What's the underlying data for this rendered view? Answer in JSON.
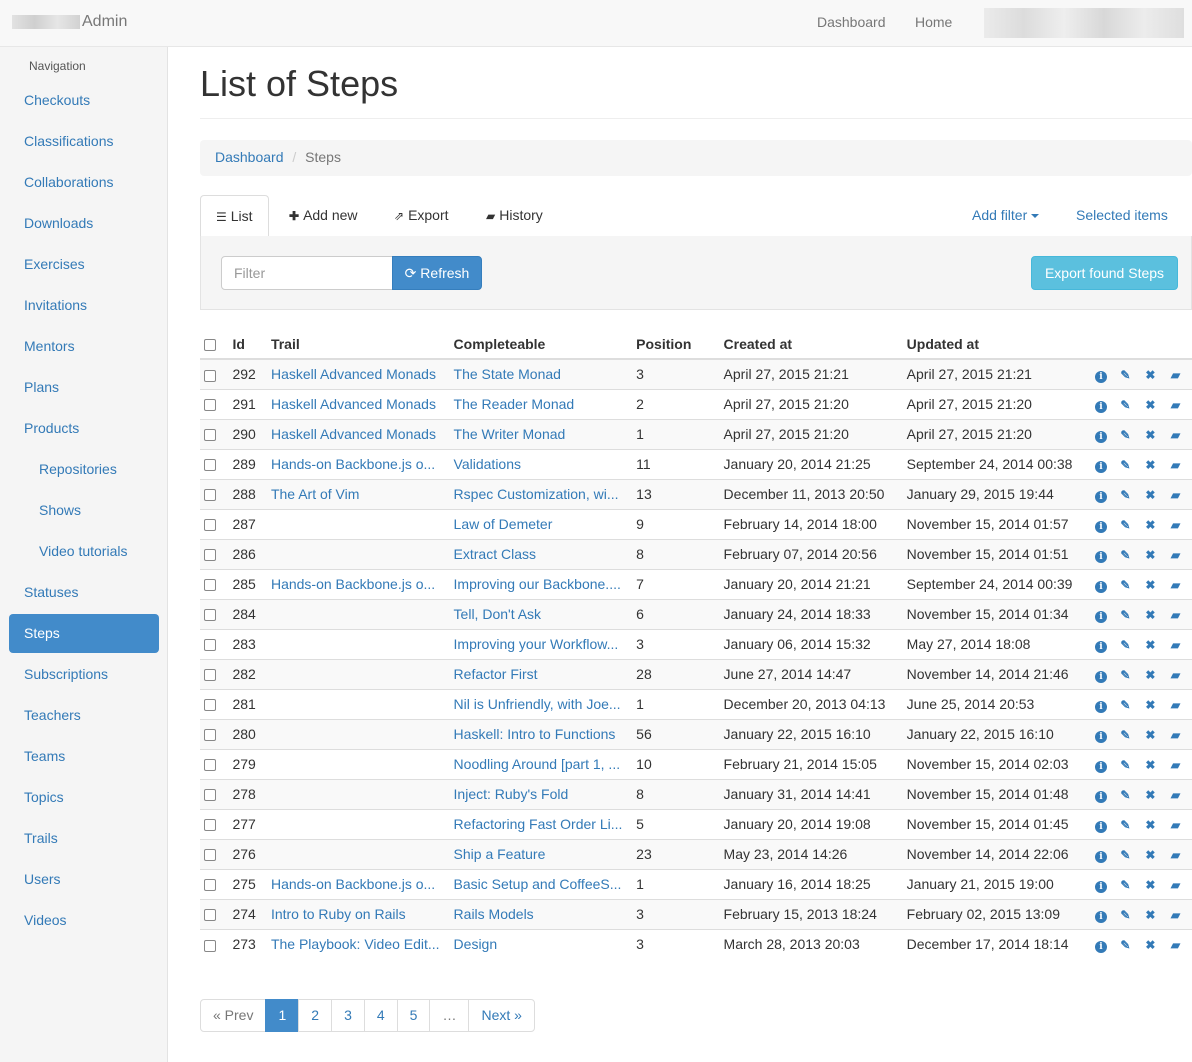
{
  "navbar": {
    "brand": "Admin",
    "links": [
      "Dashboard",
      "Home"
    ]
  },
  "sidebar": {
    "header": "Navigation",
    "items": [
      {
        "label": "Checkouts"
      },
      {
        "label": "Classifications"
      },
      {
        "label": "Collaborations"
      },
      {
        "label": "Downloads"
      },
      {
        "label": "Exercises"
      },
      {
        "label": "Invitations"
      },
      {
        "label": "Mentors"
      },
      {
        "label": "Plans"
      },
      {
        "label": "Products"
      },
      {
        "label": "Repositories",
        "sub": true
      },
      {
        "label": "Shows",
        "sub": true
      },
      {
        "label": "Video tutorials",
        "sub": true
      },
      {
        "label": "Statuses"
      },
      {
        "label": "Steps",
        "active": true
      },
      {
        "label": "Subscriptions"
      },
      {
        "label": "Teachers"
      },
      {
        "label": "Teams"
      },
      {
        "label": "Topics"
      },
      {
        "label": "Trails"
      },
      {
        "label": "Users"
      },
      {
        "label": "Videos"
      }
    ]
  },
  "page": {
    "title": "List of Steps",
    "breadcrumb": [
      "Dashboard",
      "Steps"
    ]
  },
  "tabs": {
    "list": "List",
    "add_new": "Add new",
    "export": "Export",
    "history": "History",
    "add_filter": "Add filter",
    "selected_items": "Selected items"
  },
  "filter": {
    "placeholder": "Filter",
    "refresh": "Refresh",
    "export_found": "Export found Steps"
  },
  "table": {
    "headers": [
      "Id",
      "Trail",
      "Completeable",
      "Position",
      "Created at",
      "Updated at"
    ],
    "rows": [
      [
        "292",
        "Haskell Advanced Monads",
        "The State Monad",
        "3",
        "April 27, 2015 21:21",
        "April 27, 2015 21:21"
      ],
      [
        "291",
        "Haskell Advanced Monads",
        "The Reader Monad",
        "2",
        "April 27, 2015 21:20",
        "April 27, 2015 21:20"
      ],
      [
        "290",
        "Haskell Advanced Monads",
        "The Writer Monad",
        "1",
        "April 27, 2015 21:20",
        "April 27, 2015 21:20"
      ],
      [
        "289",
        "Hands-on Backbone.js o...",
        "Validations",
        "11",
        "January 20, 2014 21:25",
        "September 24, 2014 00:38"
      ],
      [
        "288",
        "The Art of Vim",
        "Rspec Customization, wi...",
        "13",
        "December 11, 2013 20:50",
        "January 29, 2015 19:44"
      ],
      [
        "287",
        "",
        "Law of Demeter",
        "9",
        "February 14, 2014 18:00",
        "November 15, 2014 01:57"
      ],
      [
        "286",
        "",
        "Extract Class",
        "8",
        "February 07, 2014 20:56",
        "November 15, 2014 01:51"
      ],
      [
        "285",
        "Hands-on Backbone.js o...",
        "Improving our Backbone....",
        "7",
        "January 20, 2014 21:21",
        "September 24, 2014 00:39"
      ],
      [
        "284",
        "",
        "Tell, Don't Ask",
        "6",
        "January 24, 2014 18:33",
        "November 15, 2014 01:34"
      ],
      [
        "283",
        "",
        "Improving your Workflow...",
        "3",
        "January 06, 2014 15:32",
        "May 27, 2014 18:08"
      ],
      [
        "282",
        "",
        "Refactor First",
        "28",
        "June 27, 2014 14:47",
        "November 14, 2014 21:46"
      ],
      [
        "281",
        "",
        "Nil is Unfriendly, with Joe...",
        "1",
        "December 20, 2013 04:13",
        "June 25, 2014 20:53"
      ],
      [
        "280",
        "",
        "Haskell: Intro to Functions",
        "56",
        "January 22, 2015 16:10",
        "January 22, 2015 16:10"
      ],
      [
        "279",
        "",
        "Noodling Around [part 1, ...",
        "10",
        "February 21, 2014 15:05",
        "November 15, 2014 02:03"
      ],
      [
        "278",
        "",
        "Inject: Ruby's Fold",
        "8",
        "January 31, 2014 14:41",
        "November 15, 2014 01:48"
      ],
      [
        "277",
        "",
        "Refactoring Fast Order Li...",
        "5",
        "January 20, 2014 19:08",
        "November 15, 2014 01:45"
      ],
      [
        "276",
        "",
        "Ship a Feature",
        "23",
        "May 23, 2014 14:26",
        "November 14, 2014 22:06"
      ],
      [
        "275",
        "Hands-on Backbone.js o...",
        "Basic Setup and CoffeeS...",
        "1",
        "January 16, 2014 18:25",
        "January 21, 2015 19:00"
      ],
      [
        "274",
        "Intro to Ruby on Rails",
        "Rails Models",
        "3",
        "February 15, 2013 18:24",
        "February 02, 2015 13:09"
      ],
      [
        "273",
        "The Playbook: Video Edit...",
        "Design",
        "3",
        "March 28, 2013 20:03",
        "December 17, 2014 18:14"
      ]
    ],
    "row_actions": [
      "info-icon",
      "pencil-icon",
      "delete-icon",
      "book-icon"
    ]
  },
  "pagination": {
    "prev": "« Prev",
    "pages": [
      "1",
      "2",
      "3",
      "4",
      "5",
      "…"
    ],
    "next": "Next »",
    "active": "1"
  }
}
